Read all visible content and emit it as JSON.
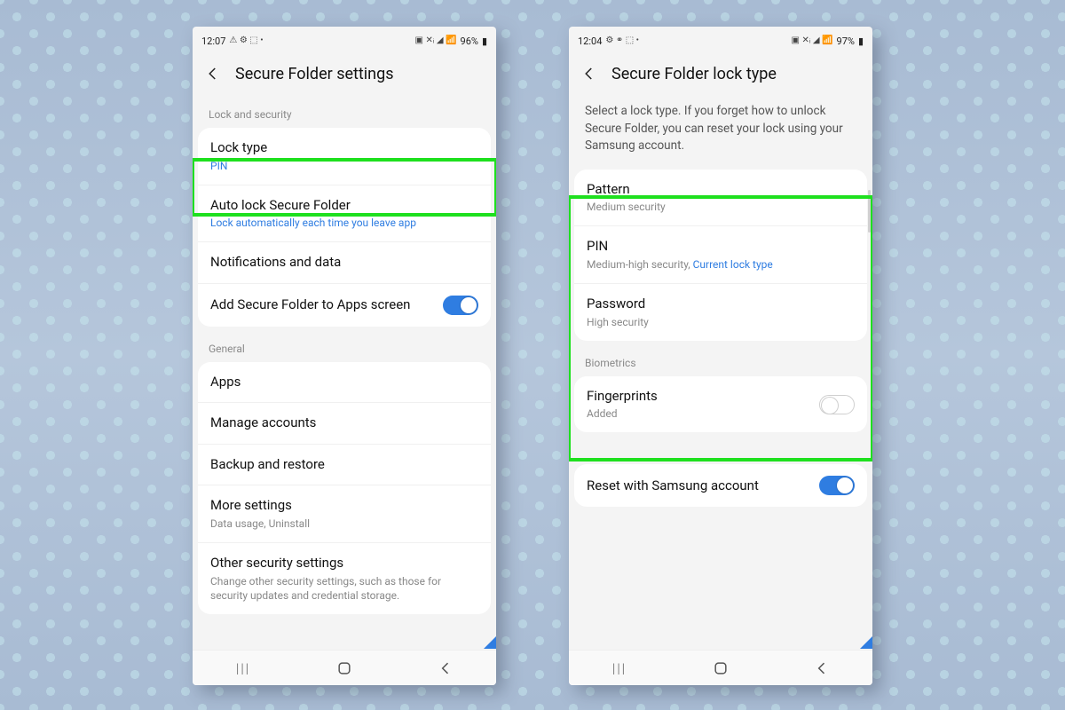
{
  "screens": [
    {
      "status": {
        "time": "12:07",
        "left_icons": "⚠ ⚙ ⬚ •",
        "right_icons": "▣ ✕ᵢ ◢ 📶",
        "battery": "96%"
      },
      "title": "Secure Folder settings",
      "sections": [
        {
          "label": "Lock and security",
          "items": [
            {
              "name": "lock-type",
              "title": "Lock type",
              "sub": "PIN",
              "sub_blue": true
            },
            {
              "name": "auto-lock",
              "title": "Auto lock Secure Folder",
              "sub": "Lock automatically each time you leave app",
              "sub_blue": true
            },
            {
              "name": "notifications-data",
              "title": "Notifications and data"
            },
            {
              "name": "add-to-apps",
              "title": "Add Secure Folder to Apps screen",
              "toggle": true,
              "toggle_on": true
            }
          ]
        },
        {
          "label": "General",
          "items": [
            {
              "name": "apps",
              "title": "Apps"
            },
            {
              "name": "manage-accounts",
              "title": "Manage accounts"
            },
            {
              "name": "backup-restore",
              "title": "Backup and restore"
            },
            {
              "name": "more-settings",
              "title": "More settings",
              "sub": "Data usage, Uninstall"
            },
            {
              "name": "other-security",
              "title": "Other security settings",
              "sub": "Change other security settings, such as those for security updates and credential storage."
            }
          ]
        }
      ]
    },
    {
      "status": {
        "time": "12:04",
        "left_icons": "⚙ ⚭ ⬚ •",
        "right_icons": "▣ ✕ᵢ ◢ 📶",
        "battery": "97%"
      },
      "title": "Secure Folder lock type",
      "info": "Select a lock type. If you forget how to unlock Secure Folder, you can reset your lock using your Samsung account.",
      "groups": [
        {
          "items": [
            {
              "name": "pattern",
              "title": "Pattern",
              "sub": "Medium security"
            },
            {
              "name": "pin",
              "title": "PIN",
              "sub": "Medium-high security, ",
              "sub_extra": "Current lock type",
              "sub_extra_blue": true
            },
            {
              "name": "password",
              "title": "Password",
              "sub": "High security"
            }
          ]
        }
      ],
      "bio_label": "Biometrics",
      "bio_item": {
        "name": "fingerprints",
        "title": "Fingerprints",
        "sub": "Added",
        "toggle": true,
        "toggle_on": false,
        "pill": true
      },
      "reset_item": {
        "name": "reset-samsung",
        "title": "Reset with Samsung account",
        "toggle": true,
        "toggle_on": true
      }
    }
  ]
}
